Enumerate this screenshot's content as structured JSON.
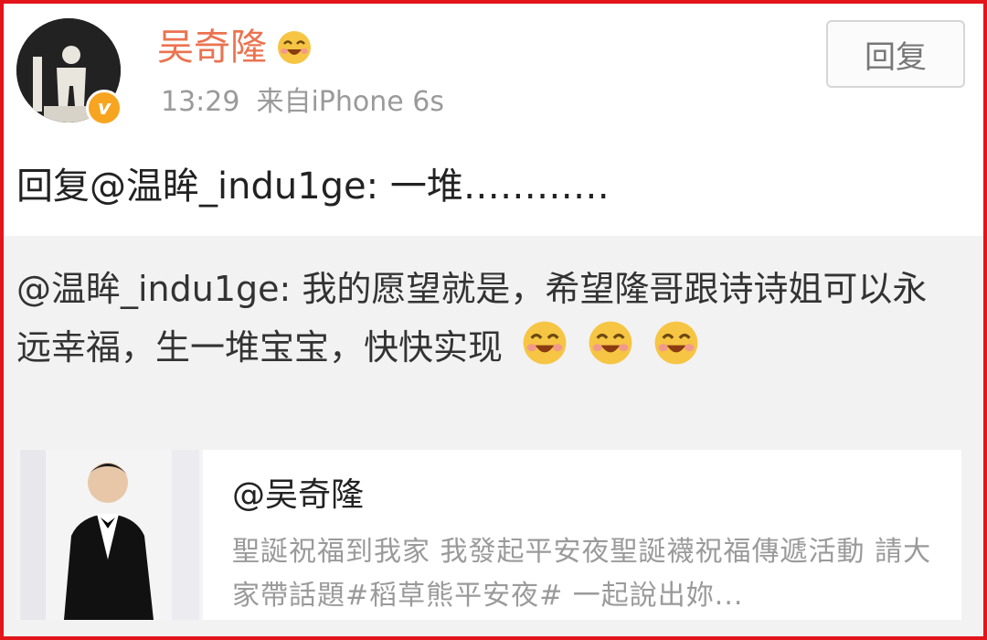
{
  "post": {
    "username": "吴奇隆",
    "username_emoji": "happy-face-emoji",
    "time": "13:29",
    "source": "来自iPhone 6s",
    "reply_button": "回复",
    "reply_text": "回复@温眸_indu1ge: 一堆…………",
    "avatar_badge": "v"
  },
  "quoted": {
    "text": "@温眸_indu1ge: 我的愿望就是，希望隆哥跟诗诗姐可以永远幸福，生一堆宝宝，快快实现",
    "emojis": [
      "happy-face-emoji",
      "happy-face-emoji",
      "happy-face-emoji"
    ]
  },
  "card": {
    "title": "@吴奇隆",
    "description": "聖誕祝福到我家 我發起平安夜聖誕襪祝福傳遞活動 請大家帶話題#稻草熊平安夜# 一起說出妳..."
  },
  "colors": {
    "username": "#eb7350",
    "meta_text": "#9a9a9a",
    "quoted_bg": "#f2f2f2",
    "frame": "#e2151b",
    "badge": "#f7a520"
  }
}
